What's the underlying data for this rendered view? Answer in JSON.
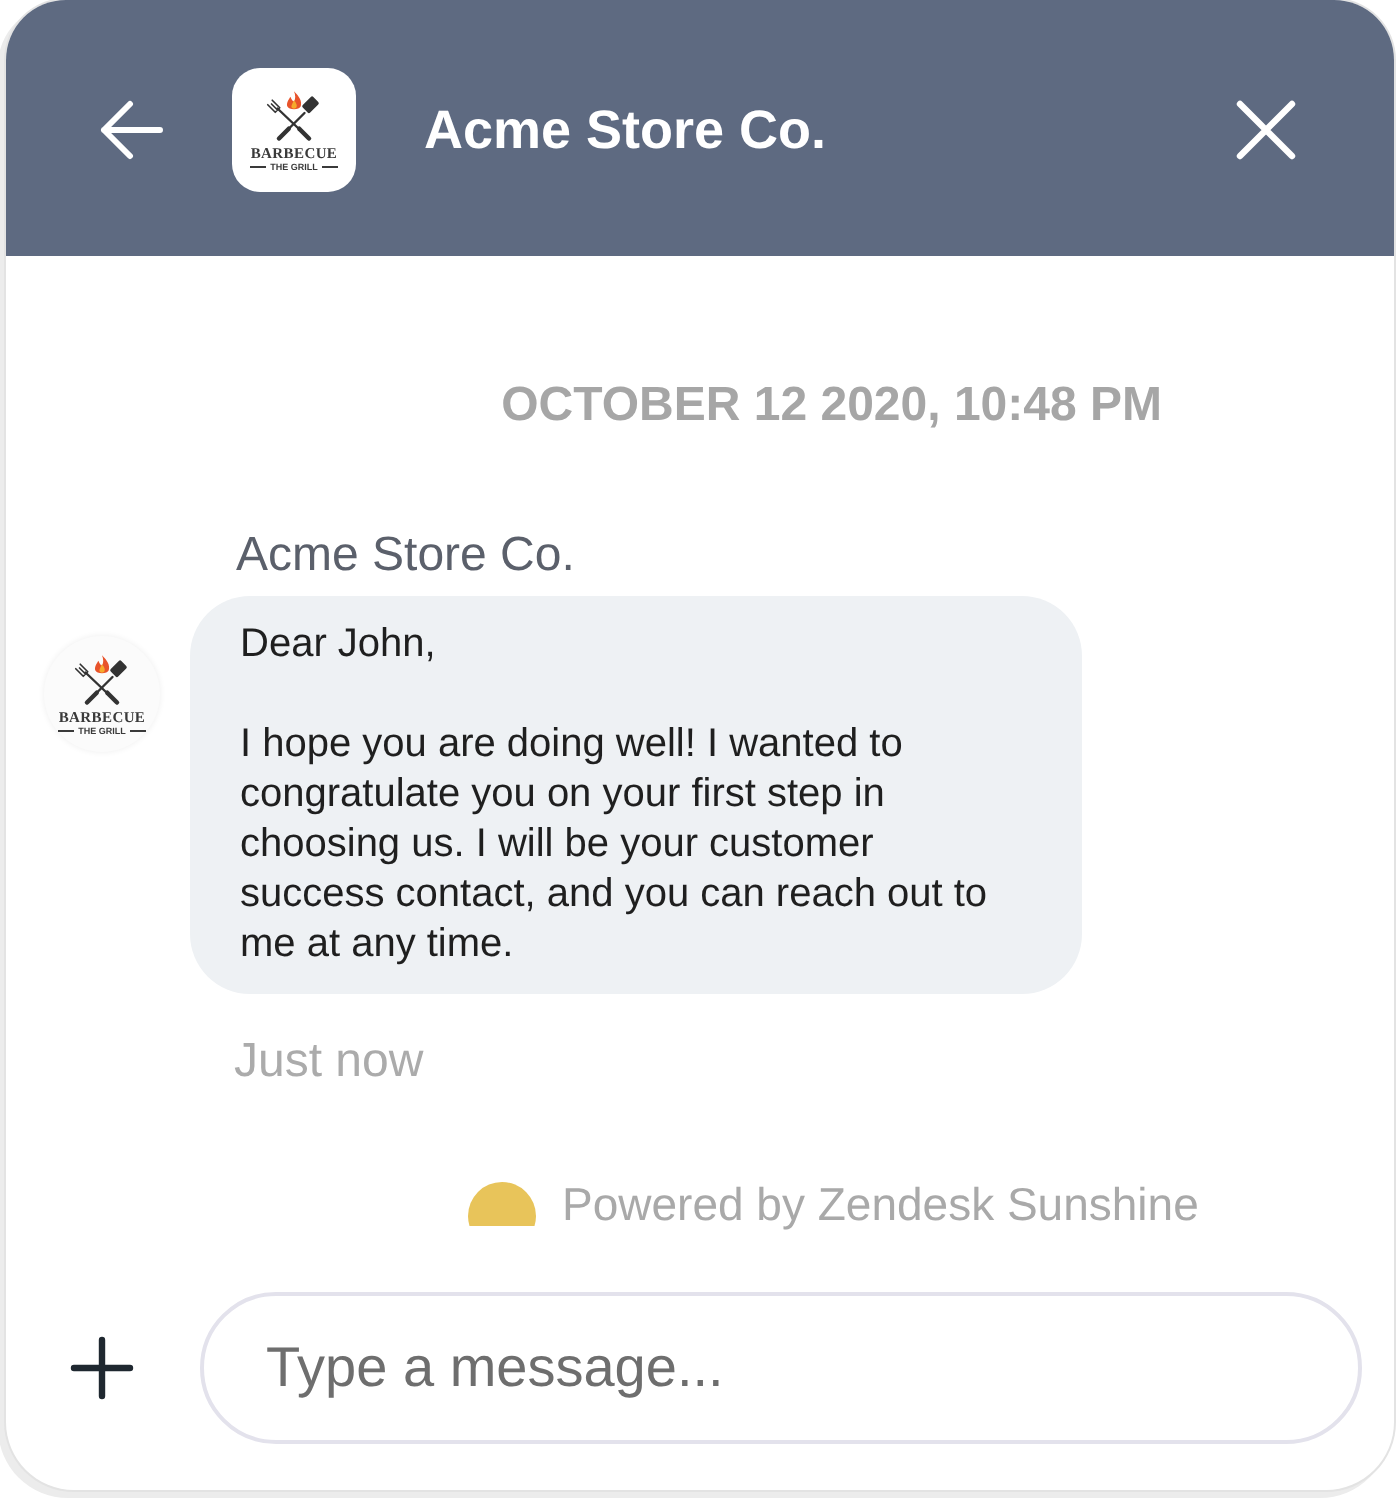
{
  "header": {
    "logo": {
      "name": "BARBECUE",
      "tagline": "THE GRILL"
    },
    "title": "Acme Store Co."
  },
  "conversation": {
    "timestamp": "OCTOBER 12 2020, 10:48 PM",
    "messages": [
      {
        "sender": "Acme Store Co.",
        "avatar": {
          "name": "BARBECUE",
          "tagline": "THE GRILL"
        },
        "paragraphs": [
          "Dear John,",
          "I hope you are doing well! I wanted to congratulate you on your first step in choosing us. I will be your customer success contact, and you can reach out to me at any time."
        ],
        "time": "Just now"
      }
    ]
  },
  "branding": {
    "text": "Powered by Zendesk Sunshine"
  },
  "composer": {
    "placeholder": "Type a message..."
  }
}
